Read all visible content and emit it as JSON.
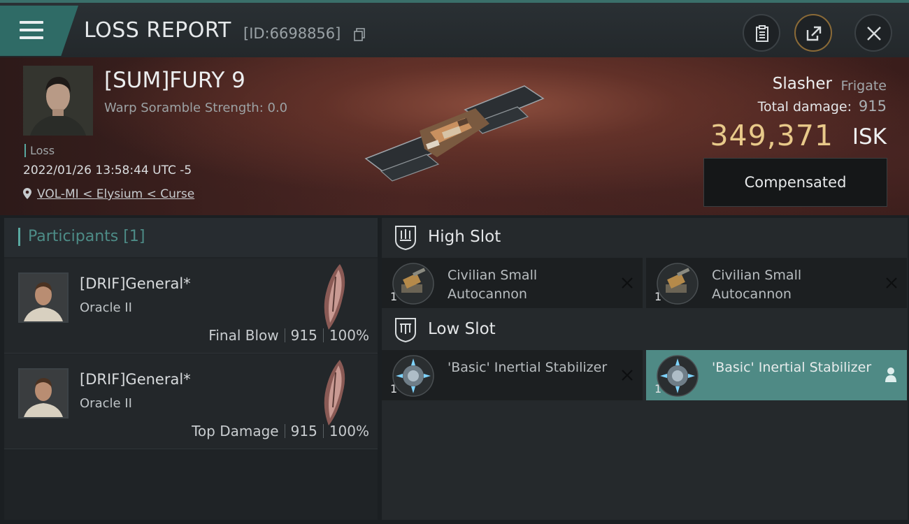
{
  "header": {
    "title": "LOSS REPORT",
    "report_id": "[ID:6698856]"
  },
  "victim": {
    "name": "[SUM]FURY 9",
    "scramble": "Warp Soramble Strength: 0.0",
    "tag": "Loss",
    "datetime": "2022/01/26 13:58:44 UTC -5",
    "location": "VOL-MI < Elysium < Curse",
    "ship_name": "Slasher",
    "ship_class": "Frigate",
    "damage_label": "Total damage:",
    "damage_value": "915",
    "isk_value": "349,371",
    "isk_unit": "ISK",
    "compensated_label": "Compensated"
  },
  "participants": {
    "title": "Participants",
    "count": "[1]",
    "rows": [
      {
        "name": "[DRIF]General*",
        "ship": "Oracle II",
        "role": "Final Blow",
        "damage": "915",
        "percent": "100%"
      },
      {
        "name": "[DRIF]General*",
        "ship": "Oracle II",
        "role": "Top Damage",
        "damage": "915",
        "percent": "100%"
      }
    ]
  },
  "slots": {
    "high": {
      "title": "High Slot",
      "modules": [
        {
          "name": "Civilian Small Autocannon",
          "qty": "1"
        },
        {
          "name": "Civilian Small Autocannon",
          "qty": "1"
        }
      ]
    },
    "low": {
      "title": "Low Slot",
      "modules": [
        {
          "name": "'Basic' Inertial Stabilizer",
          "qty": "1"
        },
        {
          "name": "'Basic' Inertial Stabilizer",
          "qty": "1"
        }
      ]
    }
  },
  "colors": {
    "accent_teal": "#4f8a85",
    "isk_gold": "#e8c98a"
  }
}
